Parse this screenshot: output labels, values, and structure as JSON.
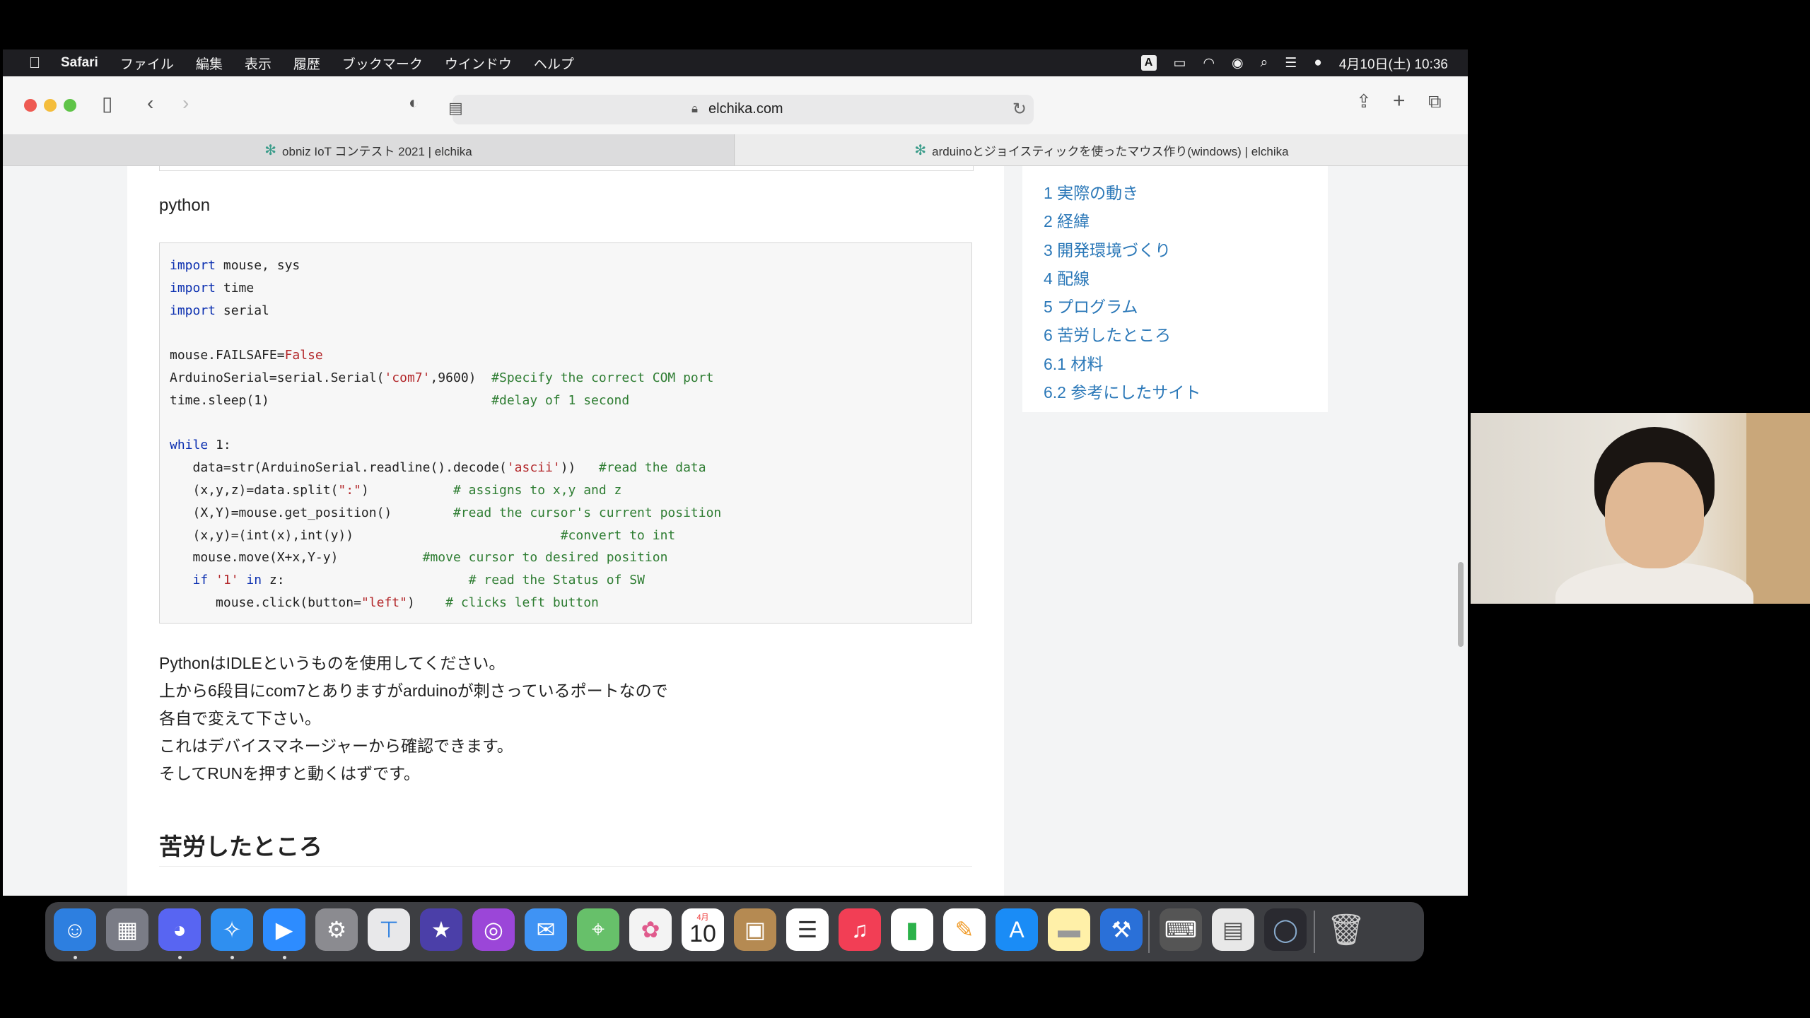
{
  "menubar": {
    "app_name": "Safari",
    "items": [
      "ファイル",
      "編集",
      "表示",
      "履歴",
      "ブックマーク",
      "ウインドウ",
      "ヘルプ"
    ],
    "input_indicator": "A",
    "datetime": "4月10日(土) 10:36"
  },
  "toolbar": {
    "url": "elchika.com"
  },
  "tabs": [
    {
      "title": "obniz IoT コンテスト 2021 | elchika",
      "active": false
    },
    {
      "title": "arduinoとジョイスティックを使ったマウス作り(windows) | elchika",
      "active": true
    }
  ],
  "article": {
    "section_label": "python",
    "code_lines": [
      "import mouse, sys",
      "import time",
      "import serial",
      "",
      "mouse.FAILSAFE=False",
      "ArduinoSerial=serial.Serial('com7',9600)  #Specify the correct COM port",
      "time.sleep(1)                             #delay of 1 second",
      "",
      "while 1:",
      "   data=str(ArduinoSerial.readline().decode('ascii'))   #read the data",
      "   (x,y,z)=data.split(\":\")           # assigns to x,y and z",
      "   (X,Y)=mouse.get_position()        #read the cursor's current position",
      "   (x,y)=(int(x),int(y))                           #convert to int",
      "   mouse.move(X+x,Y-y)           #move cursor to desired position",
      "   if '1' in z:                        # read the Status of SW",
      "      mouse.click(button=\"left\")    # clicks left button"
    ],
    "paragraph_lines": [
      "PythonはIDLEというものを使用してください。",
      "上から6段目にcom7とありますがarduinoが刺さっているポートなので",
      "各自で変えて下さい。",
      "これはデバイスマネージャーから確認できます。",
      "そしてRUNを押すと動くはずです。"
    ],
    "heading": "苦労したところ"
  },
  "toc": {
    "items": [
      "1 実際の動き",
      "2 経緯",
      "3 開発環境づくり",
      "4 配線",
      "5 プログラム",
      "6 苦労したところ",
      "6.1 材料",
      "6.2 参考にしたサイト"
    ]
  },
  "dock": {
    "calendar_month": "4月",
    "calendar_day": "10",
    "apps": [
      "finder-icon",
      "launchpad-icon",
      "discord-icon",
      "safari-icon",
      "zoom-icon",
      "system-preferences-icon",
      "keynote-icon",
      "imovie-icon",
      "podcasts-icon",
      "mail-icon",
      "maps-icon",
      "photos-icon",
      "calendar-icon",
      "contacts-icon",
      "reminders-icon",
      "music-icon",
      "numbers-icon",
      "pages-icon",
      "app-store-icon",
      "notes-icon",
      "xcode-icon",
      "utility-icon",
      "preview-icon",
      "quicktime-icon",
      "trash-icon"
    ]
  }
}
